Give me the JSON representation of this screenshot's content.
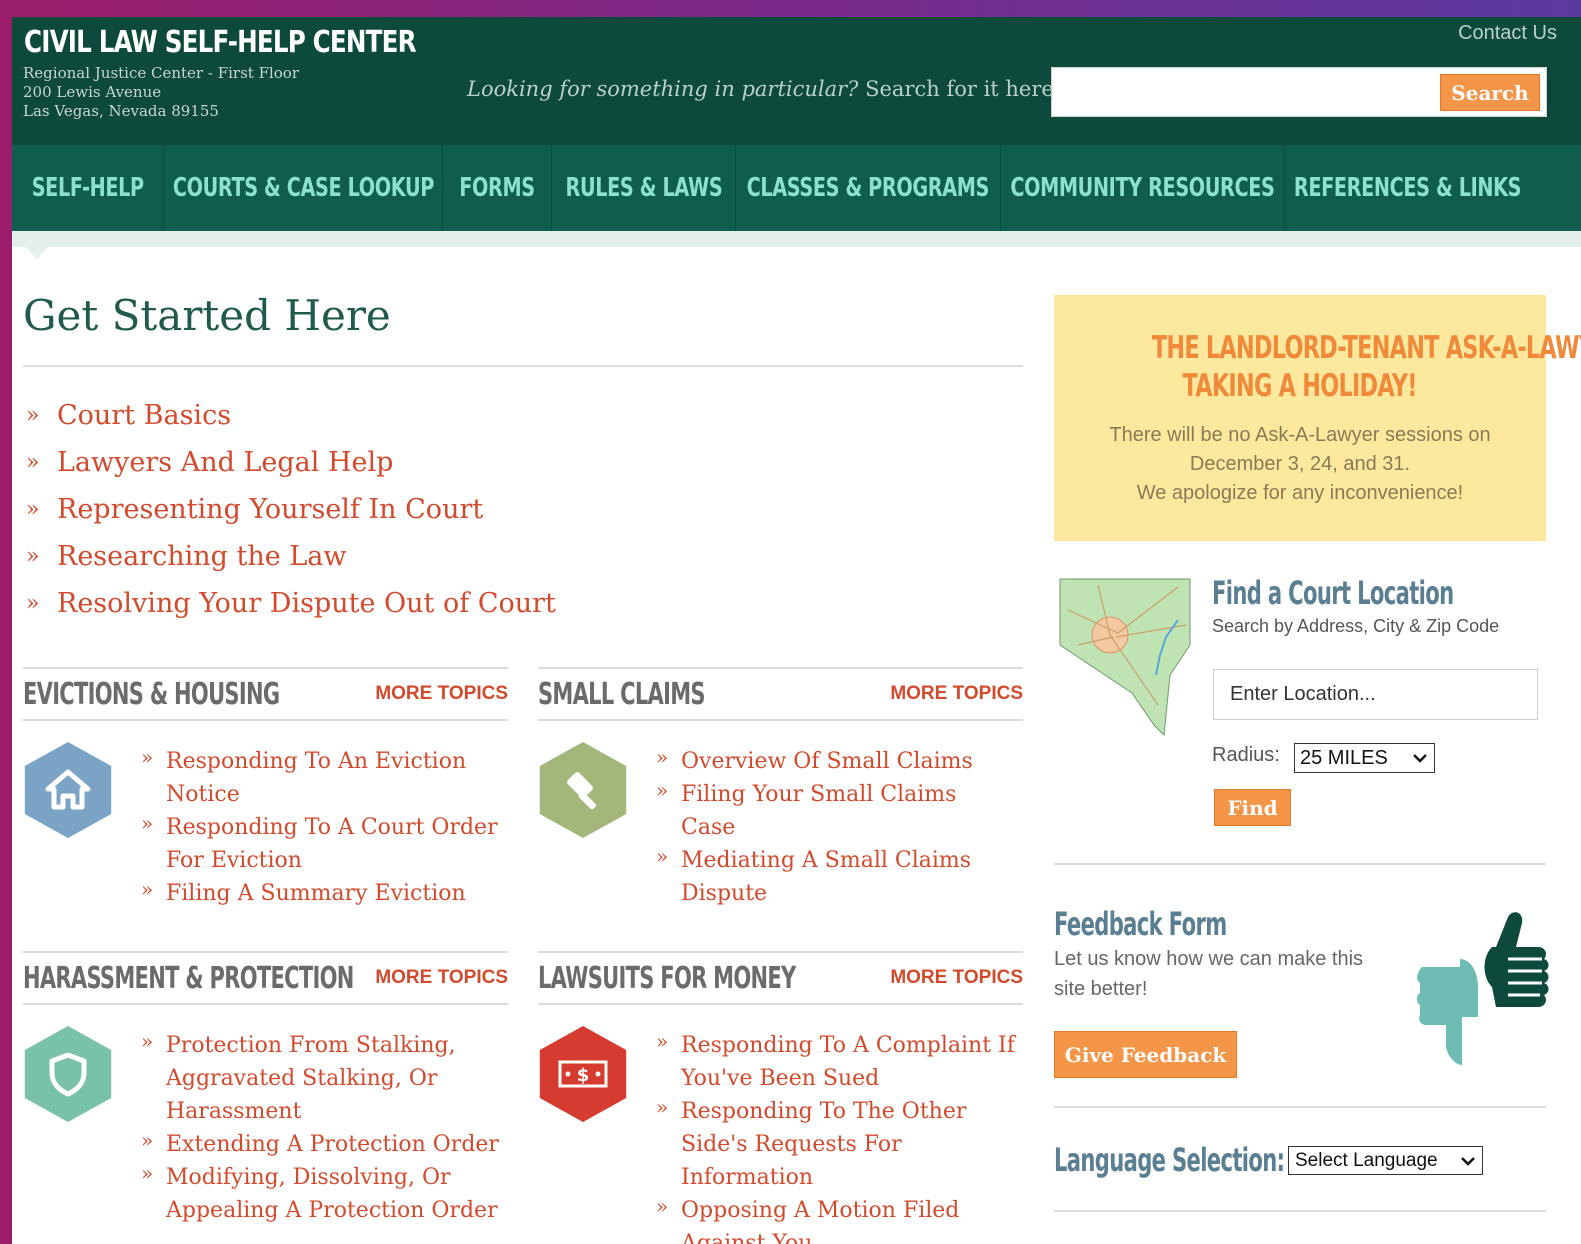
{
  "header": {
    "title": "CIVIL LAW SELF-HELP CENTER",
    "address": [
      "Regional Justice Center - First Floor",
      "200 Lewis Avenue",
      "Las Vegas, Nevada 89155"
    ],
    "contact": "Contact Us",
    "search_prompt_italic": "Looking for something in particular?",
    "search_prompt": " Search for it here",
    "search_value": "",
    "search_button": "Search"
  },
  "nav": [
    "SELF-HELP",
    "COURTS & CASE LOOKUP",
    "FORMS",
    "RULES & LAWS",
    "CLASSES & PROGRAMS",
    "COMMUNITY RESOURCES",
    "REFERENCES & LINKS"
  ],
  "main": {
    "title": "Get Started Here",
    "start_links": [
      "Court Basics",
      "Lawyers And Legal Help",
      "Representing Yourself In Court",
      "Researching the Law",
      "Resolving Your Dispute Out of Court"
    ],
    "more_label": "MORE TOPICS",
    "topics": [
      {
        "title": "EVICTIONS & HOUSING",
        "icon": "house-icon",
        "color": "#7aa3c6",
        "links": [
          "Responding To An Eviction Notice",
          "Responding To A Court Order For Eviction",
          "Filing A Summary Eviction"
        ]
      },
      {
        "title": "SMALL CLAIMS",
        "icon": "gavel-icon",
        "color": "#a4b77a",
        "links": [
          "Overview Of Small Claims",
          "Filing Your Small Claims Case",
          "Mediating A Small Claims Dispute"
        ]
      },
      {
        "title": "HARASSMENT & PROTECTION",
        "icon": "shield-icon",
        "color": "#79c2a7",
        "links": [
          "Protection From Stalking, Aggravated Stalking, Or Harassment",
          "Extending A Protection Order",
          "Modifying, Dissolving, Or Appealing A Protection Order"
        ]
      },
      {
        "title": "LAWSUITS FOR MONEY",
        "icon": "money-icon",
        "color": "#d63b2f",
        "links": [
          "Responding To A Complaint If You've Been Sued",
          "Responding To The Other Side's Requests For Information",
          "Opposing A Motion Filed Against You"
        ]
      }
    ]
  },
  "sidebar": {
    "notice_title": [
      "THE LANDLORD-TENANT ASK-A-LAWYER IS",
      "TAKING A HOLIDAY!"
    ],
    "notice_body": [
      "There will be no Ask-A-Lawyer sessions on",
      "December 3, 24, and 31.",
      "We apologize for any inconvenience!"
    ],
    "court_title": "Find a Court Location",
    "court_sub": "Search by Address, City & Zip Code",
    "location_placeholder": "Enter Location...",
    "radius_label": "Radius:",
    "radius_value": "25 MILES",
    "find_button": "Find",
    "feedback_title": "Feedback Form",
    "feedback_text": "Let us know how we can make this site better!",
    "feedback_button": "Give Feedback",
    "language_title": "Language Selection:",
    "language_value": "Select Language"
  },
  "colors": {
    "header_bg": "#0d4a3c",
    "nav_bg": "#0f5d4f",
    "nav_text": "#8ce0cf",
    "link": "#d24a2b",
    "accent_orange": "#f59547",
    "notice_bg": "#fde99d"
  }
}
